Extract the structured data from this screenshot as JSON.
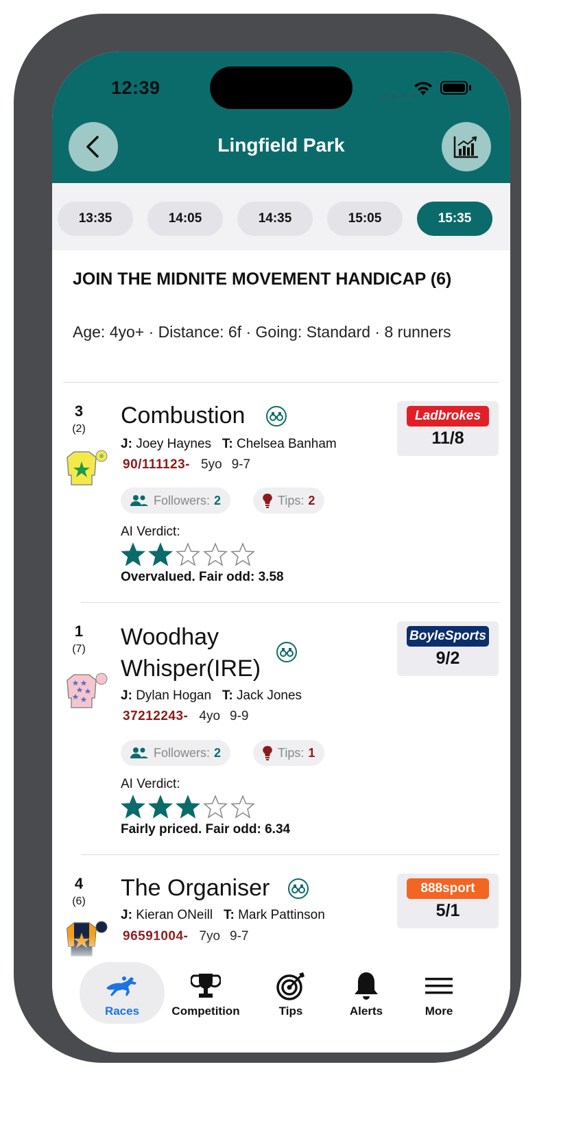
{
  "status": {
    "time": "12:39"
  },
  "header": {
    "title": "Lingfield Park"
  },
  "times": [
    "13:35",
    "14:05",
    "14:35",
    "15:05",
    "15:35"
  ],
  "active_time": "15:35",
  "race": {
    "title": "JOIN THE MIDNITE MOVEMENT HANDICAP (6)",
    "meta": "Age: 4yo+ · Distance: 6f · Going: Standard · 8 runners"
  },
  "labels": {
    "jockey": "J:",
    "trainer": "T:",
    "followers": "Followers:",
    "tips": "Tips:",
    "ai_verdict": "AI Verdict:"
  },
  "runners": [
    {
      "number": "3",
      "draw": "(2)",
      "name": "Combustion",
      "jockey": "Joey Haynes",
      "trainer": "Chelsea Banham",
      "form": "90/111123-",
      "age": "5yo",
      "weight": "9-7",
      "followers": "2",
      "tips": "2",
      "rating": 2,
      "verdict": "Overvalued. Fair odd: 3.58",
      "bookmaker": "Ladbrokes",
      "bookmaker_color": "#e01f26",
      "odds": "11/8"
    },
    {
      "number": "1",
      "draw": "(7)",
      "name": "Woodhay Whisper(IRE)",
      "jockey": "Dylan Hogan",
      "trainer": "Jack Jones",
      "form": "37212243-",
      "age": "4yo",
      "weight": "9-9",
      "followers": "2",
      "tips": "1",
      "rating": 3,
      "verdict": "Fairly priced. Fair odd: 6.34",
      "bookmaker": "BoyleSports",
      "bookmaker_color": "#0c2e6b",
      "odds": "9/2"
    },
    {
      "number": "4",
      "draw": "(6)",
      "name": "The Organiser",
      "jockey": "Kieran ONeill",
      "trainer": "Mark Pattinson",
      "form": "96591004-",
      "age": "7yo",
      "weight": "9-7",
      "bookmaker": "888sport",
      "bookmaker_color": "#f26522",
      "odds": "5/1"
    }
  ],
  "tabs": [
    {
      "label": "Races",
      "icon": "horse-racing-icon",
      "active": true
    },
    {
      "label": "Competition",
      "icon": "trophy-icon"
    },
    {
      "label": "Tips",
      "icon": "target-icon"
    },
    {
      "label": "Alerts",
      "icon": "bell-icon"
    },
    {
      "label": "More",
      "icon": "menu-icon"
    }
  ],
  "colors": {
    "primary": "#0b6b6b",
    "form": "#8b1a1a",
    "active_tab": "#1a73e8"
  }
}
